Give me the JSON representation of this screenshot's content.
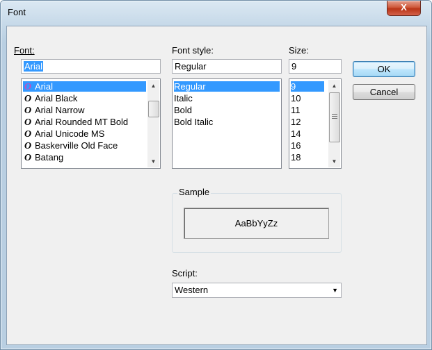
{
  "window": {
    "title": "Font",
    "close_glyph": "X"
  },
  "font": {
    "label": "Font:",
    "value": "Arial",
    "items": [
      {
        "name": "Arial",
        "selected": true
      },
      {
        "name": "Arial Black"
      },
      {
        "name": "Arial Narrow"
      },
      {
        "name": "Arial Rounded MT Bold"
      },
      {
        "name": "Arial Unicode MS"
      },
      {
        "name": "Baskerville Old Face"
      },
      {
        "name": "Batang"
      }
    ],
    "icon_glyph": "O"
  },
  "style": {
    "label": "Font style:",
    "value": "Regular",
    "items": [
      "Regular",
      "Italic",
      "Bold",
      "Bold Italic"
    ]
  },
  "size": {
    "label": "Size:",
    "value": "9",
    "items": [
      "9",
      "10",
      "11",
      "12",
      "14",
      "16",
      "18"
    ]
  },
  "buttons": {
    "ok": "OK",
    "cancel": "Cancel"
  },
  "sample": {
    "label": "Sample",
    "text": "AaBbYyZz"
  },
  "script": {
    "label": "Script:",
    "value": "Western"
  },
  "colors": {
    "selection": "#3399ff",
    "icon_selected": "#c04fc0"
  }
}
